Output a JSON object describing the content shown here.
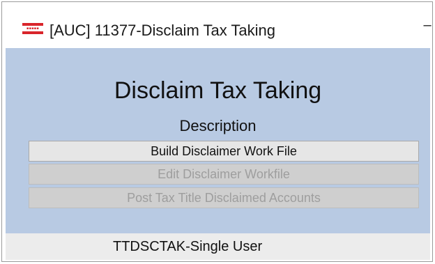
{
  "window": {
    "title": "[AUC] 11377-Disclaim Tax Taking",
    "minimize_glyph": "–",
    "logo_icon": "app-logo-icon",
    "logo_color": "#d9252b"
  },
  "main": {
    "heading": "Disclaim Tax Taking",
    "column_label": "Description",
    "background_color": "#b8cae3",
    "actions": [
      {
        "label": "Build Disclaimer Work File",
        "enabled": true
      },
      {
        "label": "Edit Disclaimer Workfile",
        "enabled": false
      },
      {
        "label": "Post Tax Title Disclaimed Accounts",
        "enabled": false
      }
    ]
  },
  "status": {
    "text": "TTDSCTAK-Single User"
  }
}
